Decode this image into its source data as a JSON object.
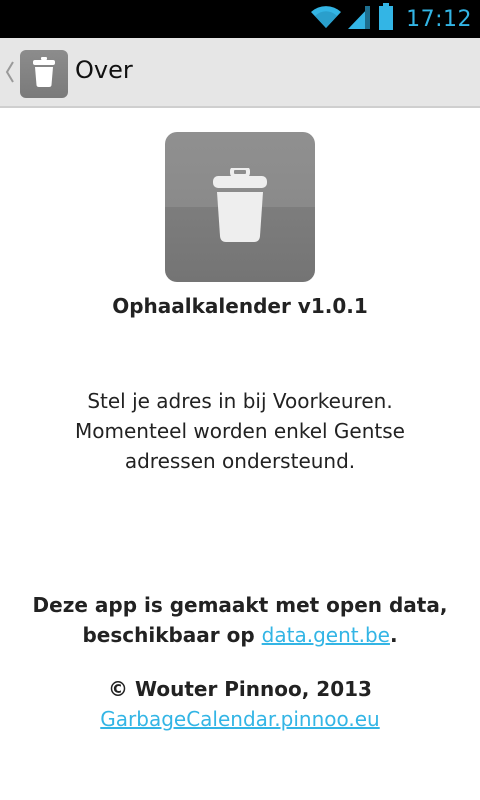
{
  "status_bar": {
    "time": "17:12",
    "icons": [
      "wifi-icon",
      "signal-icon",
      "battery-icon"
    ],
    "accent_color": "#33b5e5"
  },
  "action_bar": {
    "title": "Over",
    "icon": "trash-icon"
  },
  "about": {
    "app_name_version": "Ophaalkalender v1.0.1",
    "instructions_line1": "Stel je adres in bij Voorkeuren.",
    "instructions_line2": "Momenteel worden enkel Gentse",
    "instructions_line3": "adressen ondersteund.",
    "open_data_line1": "Deze app is gemaakt met open data,",
    "open_data_prefix": "beschikbaar op ",
    "open_data_link": "data.gent.be",
    "open_data_suffix": ".",
    "copyright": "© Wouter Pinnoo, 2013",
    "website_link": "GarbageCalendar.pinnoo.eu"
  }
}
